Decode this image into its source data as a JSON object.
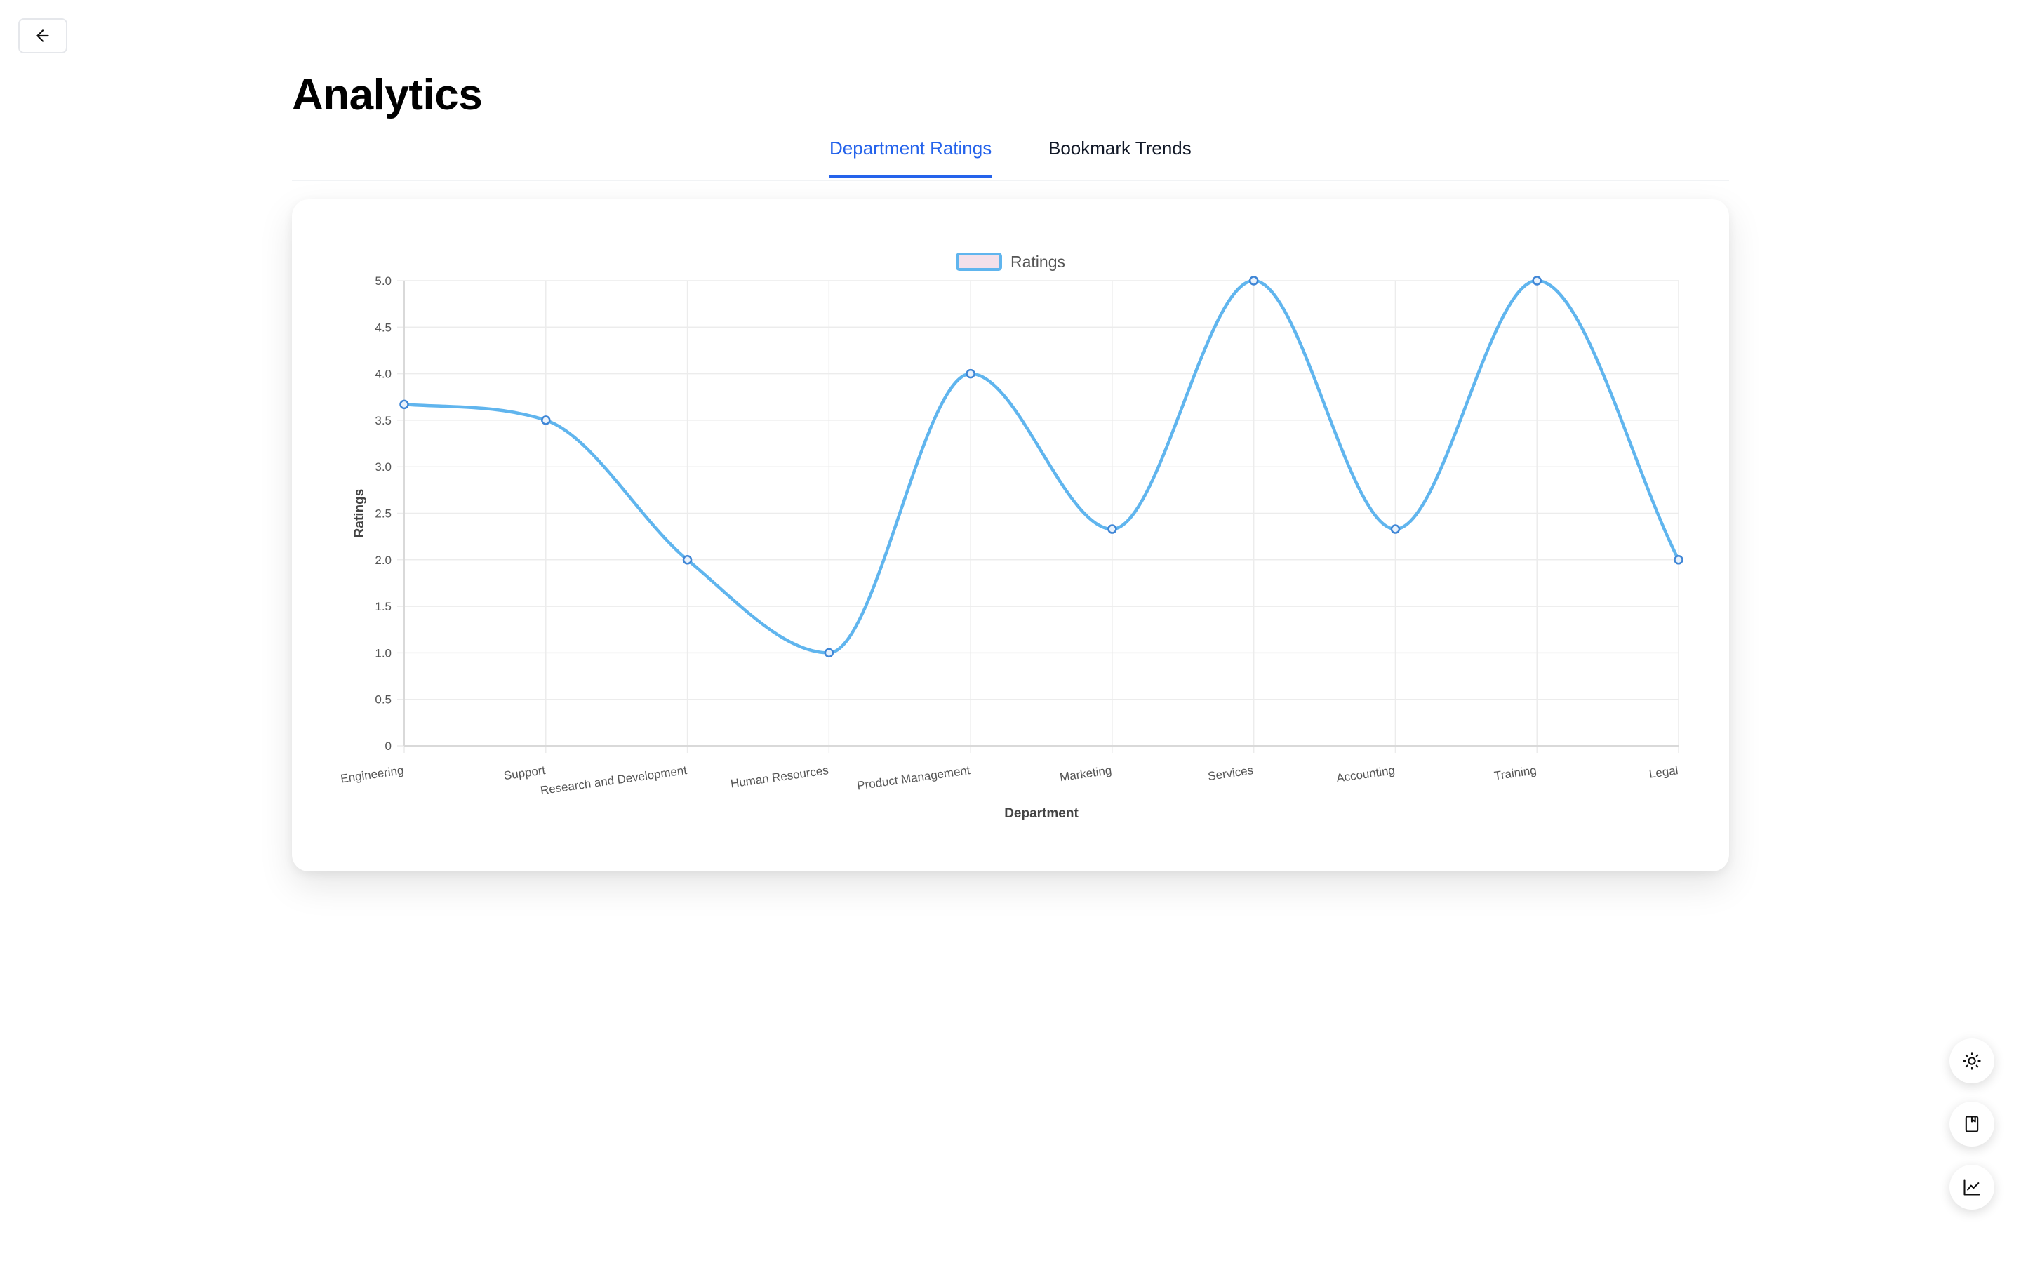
{
  "page": {
    "title": "Analytics",
    "back_icon": "arrow-left-icon"
  },
  "tabs": [
    {
      "label": "Department Ratings",
      "active": true
    },
    {
      "label": "Bookmark Trends",
      "active": false
    }
  ],
  "floating_buttons": [
    {
      "icon": "sun-icon"
    },
    {
      "icon": "bookmark-icon"
    },
    {
      "icon": "line-chart-icon"
    }
  ],
  "colors": {
    "accent": "#2563eb",
    "line": "#60b5ee",
    "legend_fill": "#f3e0ea"
  },
  "chart_data": {
    "type": "line",
    "categories": [
      "Engineering",
      "Support",
      "Research and Development",
      "Human Resources",
      "Product Management",
      "Marketing",
      "Services",
      "Accounting",
      "Training",
      "Legal"
    ],
    "series": [
      {
        "name": "Ratings",
        "values": [
          3.67,
          3.5,
          2.0,
          1.0,
          4.0,
          2.33,
          5.0,
          2.33,
          5.0,
          2.0
        ]
      }
    ],
    "xlabel": "Department",
    "ylabel": "Ratings",
    "ylim": [
      0,
      5
    ],
    "yticks": [
      "0",
      "0.5",
      "1.0",
      "1.5",
      "2.0",
      "2.5",
      "3.0",
      "3.5",
      "4.0",
      "4.5",
      "5.0"
    ],
    "legend_position": "top-center",
    "grid": true,
    "smooth": true
  }
}
